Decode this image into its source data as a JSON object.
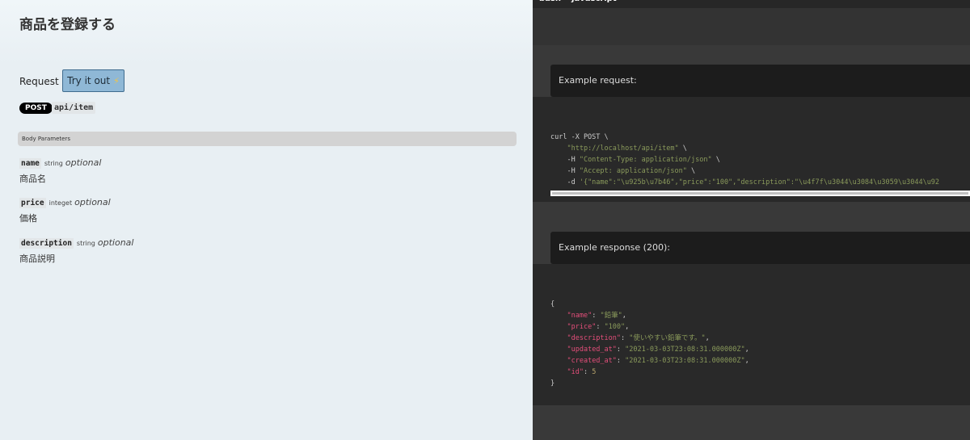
{
  "page": {
    "title": "商品を登録する"
  },
  "request": {
    "label": "Request",
    "try_button": "Try it out",
    "try_icon": "⚡",
    "method": "POST",
    "path": "api/item"
  },
  "body_params": {
    "heading": "Body Parameters",
    "items": [
      {
        "name": "name",
        "type": "string",
        "optional": "optional",
        "description": "商品名"
      },
      {
        "name": "price",
        "type": "integet",
        "optional": "optional",
        "description": "価格"
      },
      {
        "name": "description",
        "type": "string",
        "optional": "optional",
        "description": "商品説明"
      }
    ]
  },
  "right": {
    "tabs": [
      "bash",
      "javascript"
    ],
    "example_request_label": "Example request:",
    "example_response_label": "Example response (200):",
    "curl": {
      "line1": "curl -X POST \\",
      "url": "\"http://localhost/api/item\"",
      "h1": "\"Content-Type: application/json\"",
      "h2": "\"Accept: application/json\"",
      "d_prefix": "    -d ",
      "data": "'{\"name\":\"\\u925b\\u7b46\",\"price\":\"100\",\"description\":\"\\u4f7f\\u3044\\u3084\\u3059\\u3044\\u92"
    },
    "response": {
      "name": "\"鉛筆\"",
      "price": "\"100\"",
      "description": "\"使いやすい鉛筆です。\"",
      "updated_at": "\"2021-03-03T23:08:31.000000Z\"",
      "created_at": "\"2021-03-03T23:08:31.000000Z\"",
      "id": "5"
    }
  }
}
